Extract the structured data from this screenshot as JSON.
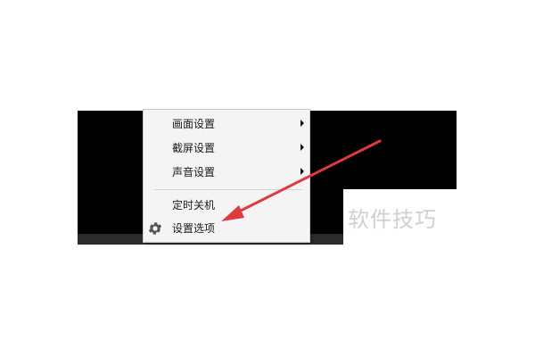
{
  "menu": {
    "items": [
      {
        "label": "画面设置",
        "has_submenu": true
      },
      {
        "label": "截屏设置",
        "has_submenu": true
      },
      {
        "label": "声音设置",
        "has_submenu": true
      },
      {
        "label": "定时关机",
        "has_submenu": false
      },
      {
        "label": "设置选项",
        "has_submenu": false,
        "icon": "gear-icon"
      }
    ]
  },
  "watermark": {
    "text": "软件技巧"
  },
  "colors": {
    "player_background": "#000000",
    "menu_background": "#f4f4f4",
    "annotation_arrow": "#e0393e"
  }
}
